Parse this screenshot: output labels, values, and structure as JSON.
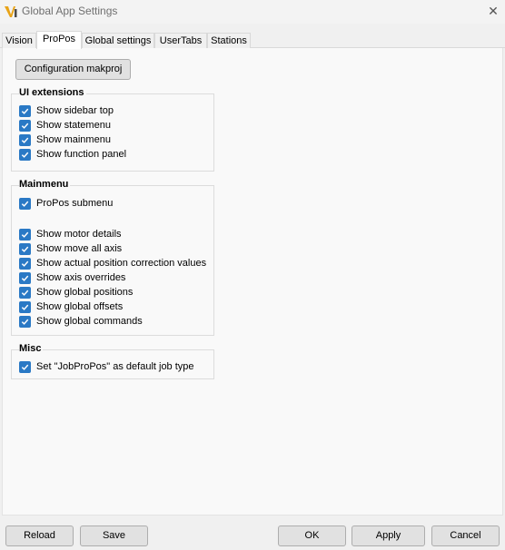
{
  "window": {
    "title": "Global App Settings",
    "close_glyph": "✕"
  },
  "tabs": [
    {
      "label": "Vision",
      "active": false
    },
    {
      "label": "ProPos",
      "active": true
    },
    {
      "label": "Global settings",
      "active": false
    },
    {
      "label": "UserTabs",
      "active": false
    },
    {
      "label": "Stations",
      "active": false
    }
  ],
  "config_button": "Configuration makproj",
  "groups": {
    "ui_extensions": {
      "title": "UI extensions",
      "items": [
        {
          "label": "Show sidebar top",
          "checked": true
        },
        {
          "label": "Show statemenu",
          "checked": true
        },
        {
          "label": "Show mainmenu",
          "checked": true
        },
        {
          "label": "Show function panel",
          "checked": true
        }
      ]
    },
    "mainmenu": {
      "title": "Mainmenu",
      "items": [
        {
          "label": "ProPos submenu",
          "checked": true
        },
        {
          "label": "Show motor details",
          "checked": true
        },
        {
          "label": "Show move all axis",
          "checked": true
        },
        {
          "label": "Show actual position correction values",
          "checked": true
        },
        {
          "label": "Show axis overrides",
          "checked": true
        },
        {
          "label": "Show global positions",
          "checked": true
        },
        {
          "label": "Show global offsets",
          "checked": true
        },
        {
          "label": "Show global commands",
          "checked": true
        }
      ]
    },
    "misc": {
      "title": "Misc",
      "items": [
        {
          "label": "Set \"JobProPos\" as default job type",
          "checked": true
        }
      ]
    }
  },
  "footer": {
    "reload": "Reload",
    "save": "Save",
    "ok": "OK",
    "apply": "Apply",
    "cancel": "Cancel"
  },
  "colors": {
    "checkbox": "#2a79c5",
    "logo_orange": "#e8a317"
  }
}
